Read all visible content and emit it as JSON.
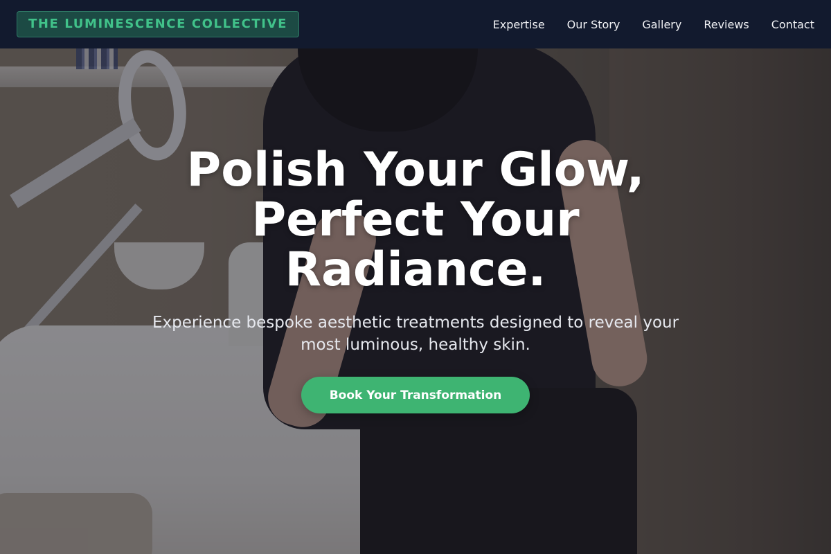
{
  "brand": {
    "name": "THE LUMINESCENCE COLLECTIVE"
  },
  "nav": {
    "items": [
      {
        "label": "Expertise"
      },
      {
        "label": "Our Story"
      },
      {
        "label": "Gallery"
      },
      {
        "label": "Reviews"
      },
      {
        "label": "Contact"
      }
    ]
  },
  "hero": {
    "title": "Polish Your Glow, Perfect Your Radiance.",
    "subtitle": "Experience bespoke aesthetic treatments designed to reveal your most luminous, healthy skin.",
    "cta_label": "Book Your Transformation",
    "background": "spa-treatment-room-photo"
  },
  "colors": {
    "accent": "#3eb472",
    "brand_text": "#41c28a",
    "navbar_bg": "#121a2e"
  }
}
